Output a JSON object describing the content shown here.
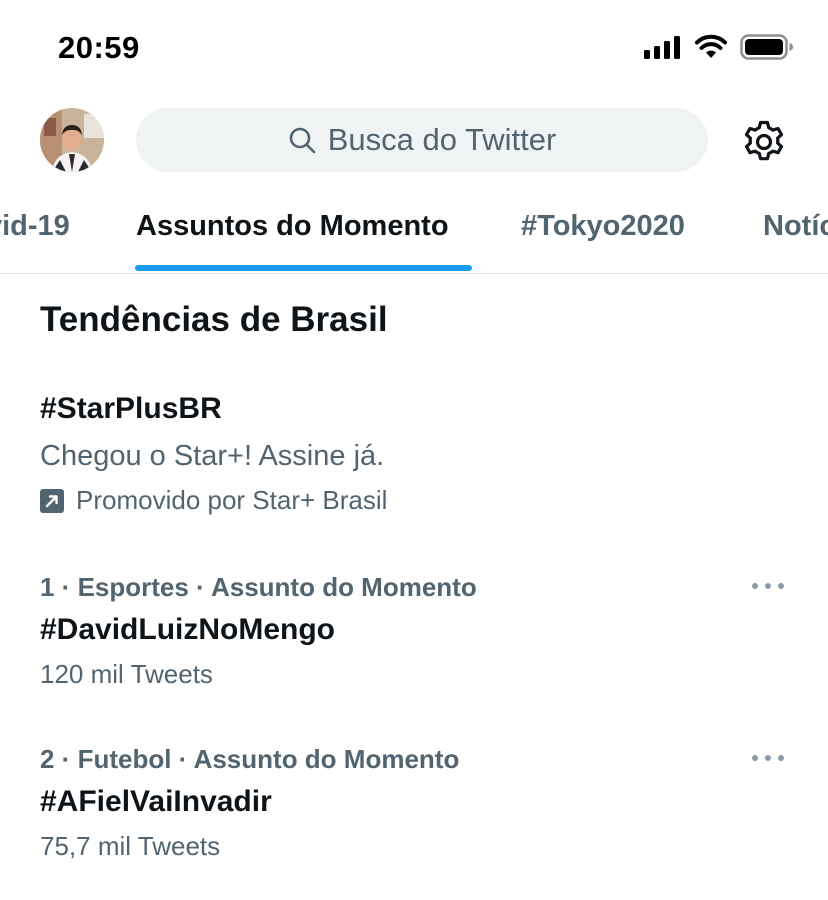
{
  "status_bar": {
    "time": "20:59"
  },
  "search": {
    "placeholder": "Busca do Twitter"
  },
  "tabs": [
    {
      "label": "vid-19"
    },
    {
      "label": "Assuntos do Momento"
    },
    {
      "label": "#Tokyo2020"
    },
    {
      "label": "Notíc"
    }
  ],
  "section_title": "Tendências de Brasil",
  "promoted": {
    "hashtag": "#StarPlusBR",
    "description": "Chegou o Star+! Assine já.",
    "promoted_by": "Promovido por Star+ Brasil"
  },
  "trends": [
    {
      "meta": "1 · Esportes · Assunto do Momento",
      "name": "#DavidLuizNoMengo",
      "count": "120 mil Tweets"
    },
    {
      "meta": "2 · Futebol · Assunto do Momento",
      "name": "#AFielVaiInvadir",
      "count": "75,7 mil Tweets"
    }
  ],
  "colors": {
    "accent": "#1d9bf0",
    "secondary_text": "#536471",
    "primary_text": "#0f1419",
    "search_bg": "#eff3f4"
  },
  "icons": [
    "signal-icon",
    "wifi-icon",
    "battery-icon",
    "search-icon",
    "gear-icon",
    "promoted-arrow-icon",
    "more-icon"
  ]
}
